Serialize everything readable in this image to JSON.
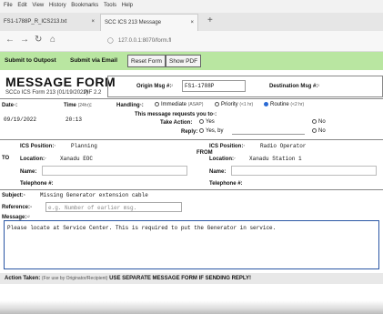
{
  "menu": [
    "File",
    "Edit",
    "View",
    "History",
    "Bookmarks",
    "Tools",
    "Help"
  ],
  "tabs": [
    {
      "label": "FS1-1788P_R_ICS213.txt"
    },
    {
      "label": "SCC ICS 213 Message"
    }
  ],
  "nav": {
    "url": "127.0.0.1:8070/form.fl"
  },
  "toolbar": {
    "submit_outpost": "Submit to Outpost",
    "submit_email": "Submit via Email",
    "reset": "Reset Form",
    "show_pdf": "Show PDF"
  },
  "form": {
    "title": "MESSAGE FORM",
    "subtitle": "SCCo ICS Form 213 (01/19/2022)",
    "pif": "PIF 2.2",
    "origin_label": "Origin Msg #:",
    "origin_value": "FS1-1788P",
    "dest_label": "Destination Msg #:",
    "date_label": "Date",
    "date_value": "09/19/2022",
    "time_label": "Time",
    "time_hint": "(24hr)",
    "time_value": "20:13",
    "handling_label": "Handling",
    "handling_options": [
      "Immediate",
      "Priority",
      "Routine"
    ],
    "handling_hints": [
      "(ASAP)",
      "(<1 hr)",
      "(<2 hr)"
    ],
    "requests_label": "This message requests you to",
    "take_action_label": "Take Action:",
    "reply_label": "Reply:",
    "yes_label": "Yes",
    "no_label": "No",
    "yes_by_label": "Yes, by",
    "to_label": "TO",
    "from_label": "FROM",
    "to_ics_label": "ICS Position:",
    "to_ics_value": "Planning",
    "to_location_label": "Location:",
    "to_location_value": "Xanadu EOC",
    "to_name_label": "Name:",
    "to_phone_label": "Telephone #:",
    "from_ics_label": "ICS Position:",
    "from_ics_value": "Radio Operator",
    "from_location_label": "Location:",
    "from_location_value": "Xanadu Station 1",
    "from_name_label": "Name:",
    "from_phone_label": "Telephone #:",
    "subject_label": "Subject:",
    "subject_value": "Missing Generator extension cable",
    "reference_label": "Reference:",
    "reference_placeholder": "e.g. Number of earlier msg.",
    "message_label": "Message:",
    "message_value": "Please locate at Service Center.  This is required to put the Generator in service.",
    "action_taken": "Action Taken:",
    "action_hint": "(For use by Originator/Recipient)",
    "action_warning": "USE SEPARATE MESSAGE FORM IF SENDING REPLY!"
  }
}
